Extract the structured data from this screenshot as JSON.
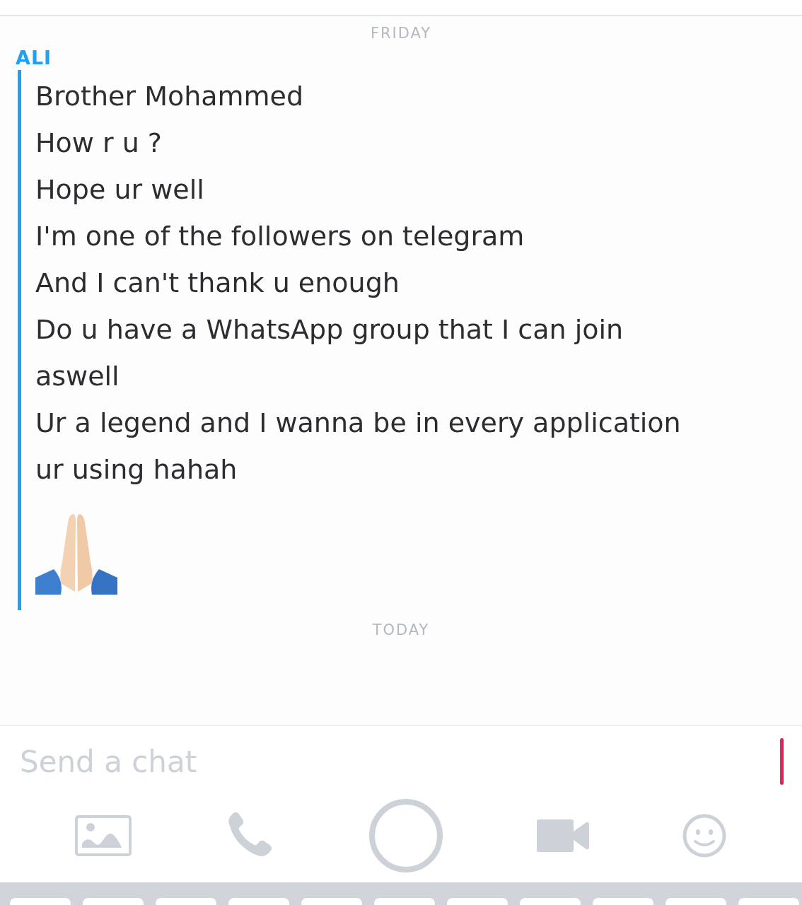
{
  "conversation": [
    {
      "kind": "date",
      "label": "FRIDAY"
    },
    {
      "kind": "message",
      "sender": "ALI",
      "lines": [
        "Brother Mohammed",
        "How r u ?",
        "Hope ur well",
        "I'm one of the followers on telegram",
        "And I can't thank u enough",
        "Do u have a WhatsApp group that I can join aswell",
        "Ur a legend and I wanna be in every application ur using hahah"
      ]
    },
    {
      "kind": "date",
      "label": "TODAY"
    }
  ],
  "composer": {
    "placeholder": "Send a chat"
  }
}
